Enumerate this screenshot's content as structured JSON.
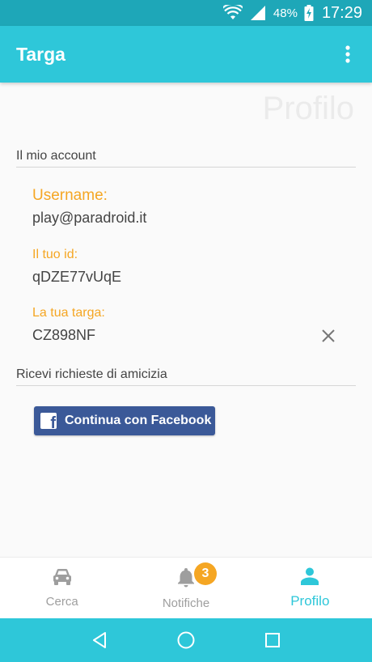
{
  "status_bar": {
    "battery_percent": "48%",
    "time": "17:29"
  },
  "app_bar": {
    "title": "Targa",
    "menu_icon": "more-vert-icon"
  },
  "page": {
    "heading": "Profilo"
  },
  "account_section": {
    "header": "Il mio account",
    "fields": [
      {
        "label": "Username:",
        "value": "play@paradroid.it"
      },
      {
        "label": "Il tuo id:",
        "value": "qDZE77vUqE"
      },
      {
        "label": "La tua targa:",
        "value": "CZ898NF"
      }
    ],
    "clear_icon": "close-icon"
  },
  "friend_section": {
    "header": "Ricevi richieste di amicizia",
    "facebook_button": "Continua con Facebook",
    "facebook_icon": "facebook-icon"
  },
  "bottom_nav": {
    "items": [
      {
        "label": "Cerca",
        "icon": "car-icon",
        "active": false
      },
      {
        "label": "Notifiche",
        "icon": "bell-icon",
        "active": false,
        "badge": "3"
      },
      {
        "label": "Profilo",
        "icon": "person-icon",
        "active": true
      }
    ]
  },
  "system_nav": [
    "back-icon",
    "home-icon",
    "recents-icon"
  ],
  "colors": {
    "primary": "#2ec7d9",
    "status_bar": "#1ea7b8",
    "accent": "#f5a623",
    "facebook": "#3b5998",
    "inactive": "#9e9e9e"
  }
}
